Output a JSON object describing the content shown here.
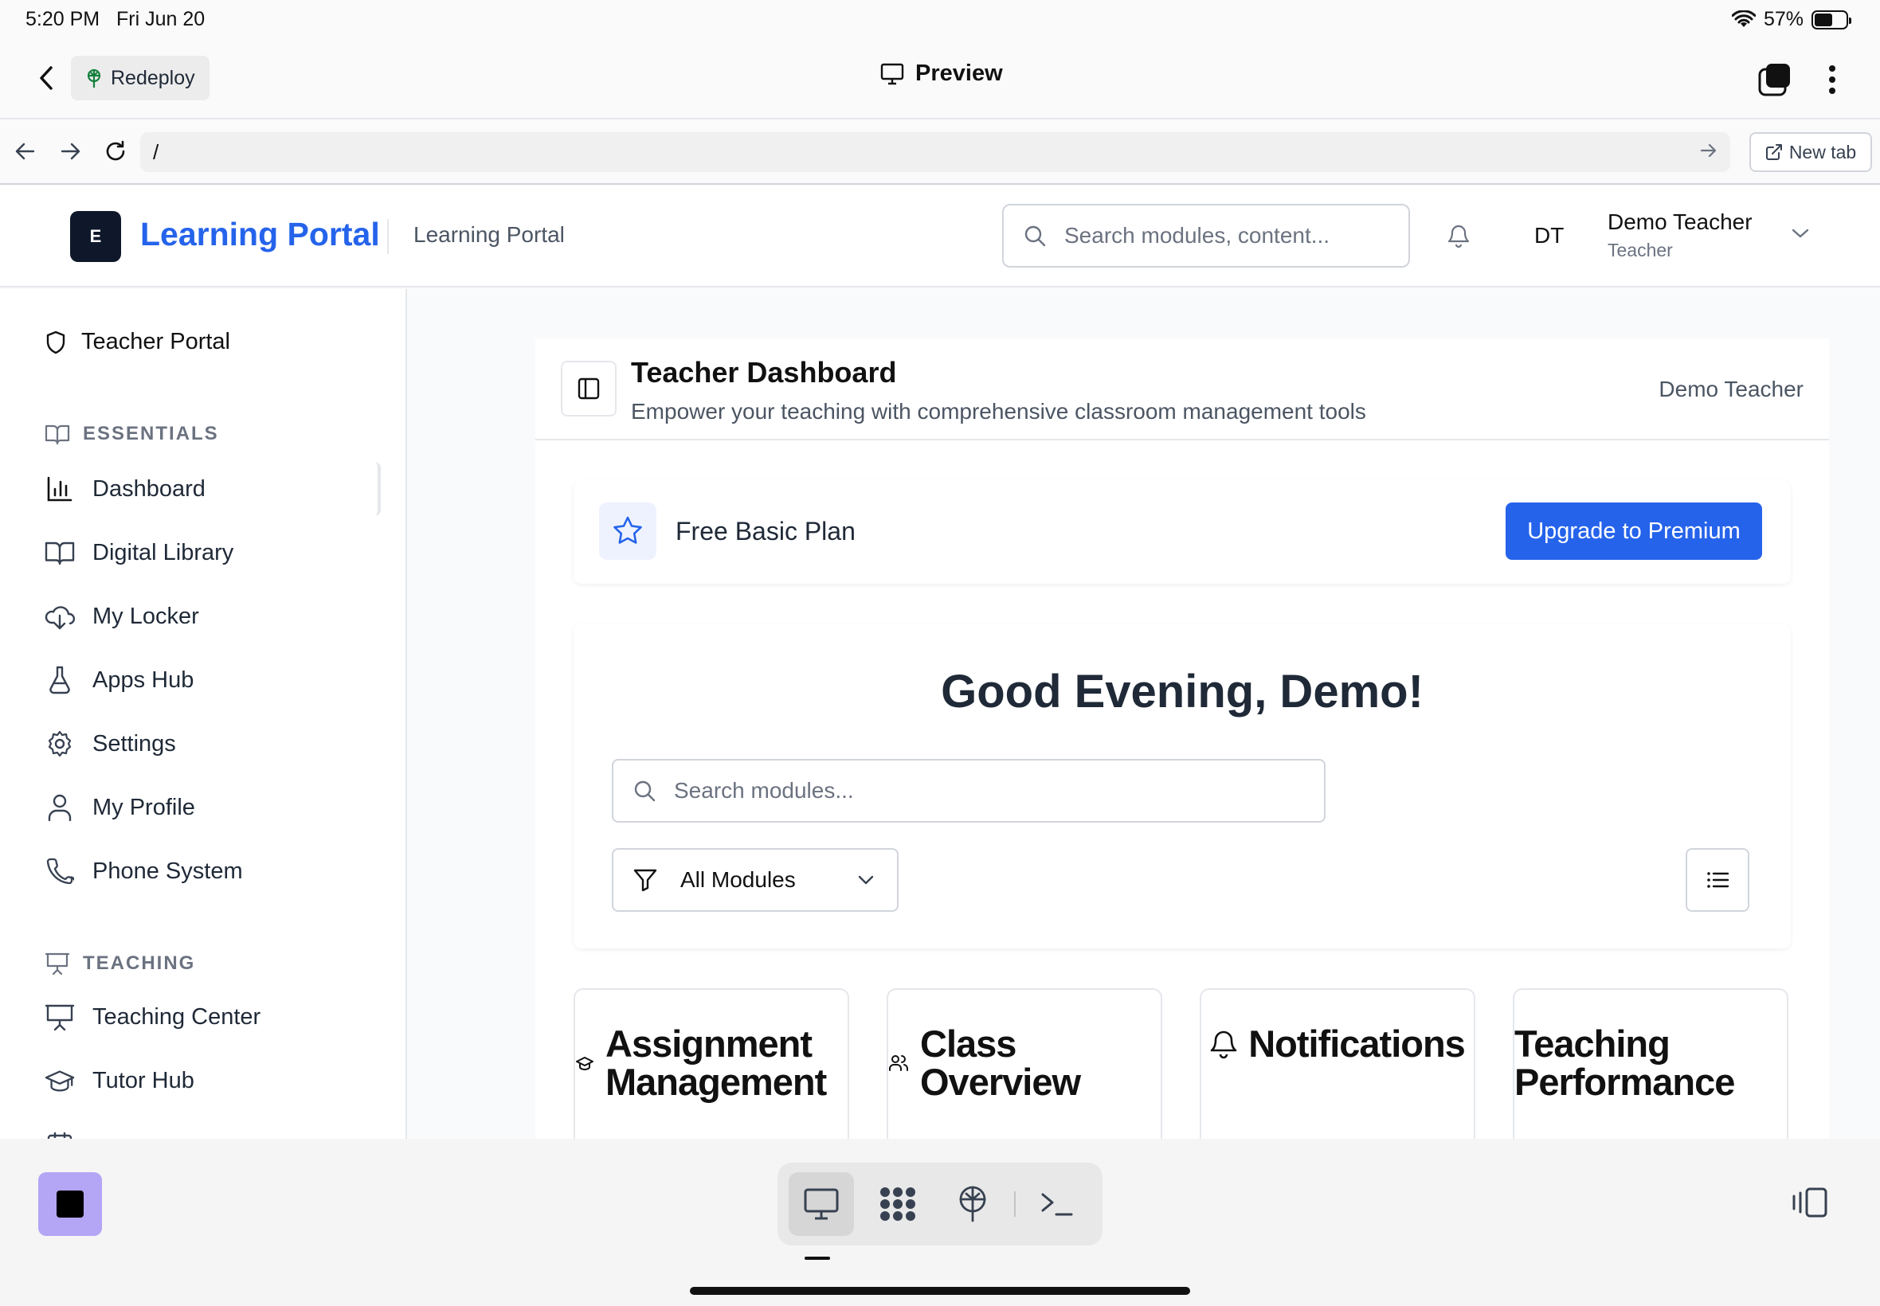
{
  "status": {
    "time": "5:20 PM",
    "date": "Fri Jun 20",
    "battery": "57%",
    "battery_level": 0.57
  },
  "app_bar": {
    "redeploy_label": "Redeploy",
    "title": "Preview"
  },
  "browser": {
    "url": "/",
    "new_tab_label": "New tab"
  },
  "header": {
    "logo_letter": "E",
    "brand": "Learning Portal",
    "subtitle": "Learning Portal",
    "search_placeholder": "Search modules, content...",
    "user_initials": "DT",
    "user_name": "Demo Teacher",
    "user_role": "Teacher"
  },
  "sidebar": {
    "portal_label": "Teacher Portal",
    "essentials_heading": "ESSENTIALS",
    "essentials": [
      {
        "label": "Dashboard",
        "icon": "bar-chart-icon"
      },
      {
        "label": "Digital Library",
        "icon": "book-open-icon"
      },
      {
        "label": "My Locker",
        "icon": "cloud-download-icon"
      },
      {
        "label": "Apps Hub",
        "icon": "flask-icon"
      },
      {
        "label": "Settings",
        "icon": "gear-icon"
      },
      {
        "label": "My Profile",
        "icon": "user-icon"
      },
      {
        "label": "Phone System",
        "icon": "phone-icon"
      }
    ],
    "teaching_heading": "TEACHING",
    "teaching": [
      {
        "label": "Teaching Center",
        "icon": "presentation-icon"
      },
      {
        "label": "Tutor Hub",
        "icon": "graduation-cap-icon"
      }
    ]
  },
  "dashboard": {
    "title": "Teacher Dashboard",
    "subtitle": "Empower your teaching with comprehensive classroom management tools",
    "user": "Demo Teacher",
    "plan_name": "Free Basic Plan",
    "upgrade_label": "Upgrade to Premium",
    "greeting": "Good Evening, Demo!",
    "module_search_placeholder": "Search modules...",
    "filter_value": "All Modules",
    "modules": [
      {
        "title": "Assignment Management",
        "icon": "graduation-cap-icon"
      },
      {
        "title": "Class Overview",
        "icon": "users-icon"
      },
      {
        "title": "Notifications",
        "icon": "bell-icon"
      },
      {
        "title": "Teaching Performance",
        "icon": ""
      }
    ]
  },
  "colors": {
    "accent": "#2563eb",
    "stop_button": "#b4a5f5",
    "logo_bg": "#0f172a"
  }
}
